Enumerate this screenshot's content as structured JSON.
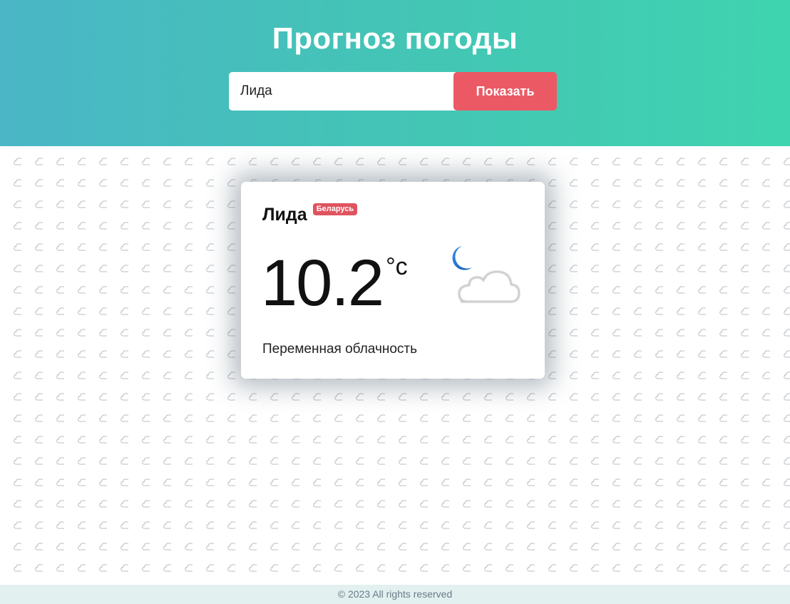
{
  "header": {
    "title": "Прогноз погоды",
    "search_value": "Лида",
    "button_label": "Показать"
  },
  "weather": {
    "city": "Лида",
    "country": "Беларусь",
    "temperature": "10.2",
    "unit": "°c",
    "description": "Переменная облачность",
    "icon": "moon-cloud-icon"
  },
  "footer": {
    "text": "© 2023 All rights reserved"
  },
  "colors": {
    "header_gradient_start": "#4ab6c6",
    "header_gradient_end": "#3fd4b0",
    "button": "#eb5965",
    "badge": "#e0545f",
    "footer_bg": "#e2f1ef"
  }
}
